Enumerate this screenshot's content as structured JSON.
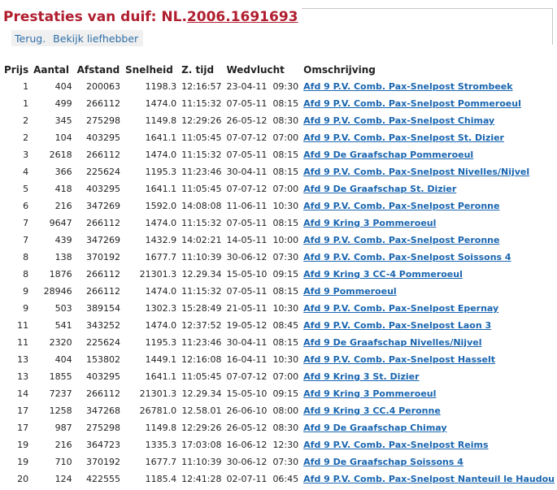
{
  "header": {
    "title_prefix": "Prestaties van duif: NL.",
    "ring_number": "2006.1691693",
    "nav": [
      {
        "label": "Terug."
      },
      {
        "label": "Bekijk liefhebber"
      }
    ]
  },
  "table": {
    "columns": [
      "Prijs",
      "Aantal",
      "Afstand",
      "Snelheid",
      "Z. tijd",
      "Wedvlucht",
      "Omschrijving"
    ],
    "rows": [
      {
        "prijs": "1",
        "aantal": "404",
        "afstand": "200063",
        "snelheid": "1198.3",
        "ztijd": "12:16:57",
        "datum": "23-04-11",
        "tijd": "09:30",
        "omschrijving": "Afd 9 P.V. Comb. Pax-Snelpost Strombeek"
      },
      {
        "prijs": "1",
        "aantal": "499",
        "afstand": "266112",
        "snelheid": "1474.0",
        "ztijd": "11:15:32",
        "datum": "07-05-11",
        "tijd": "08:15",
        "omschrijving": "Afd 9 P.V. Comb. Pax-Snelpost Pommeroeul"
      },
      {
        "prijs": "2",
        "aantal": "345",
        "afstand": "275298",
        "snelheid": "1149.8",
        "ztijd": "12:29:26",
        "datum": "26-05-12",
        "tijd": "08:30",
        "omschrijving": "Afd 9 P.V. Comb. Pax-Snelpost Chimay"
      },
      {
        "prijs": "2",
        "aantal": "104",
        "afstand": "403295",
        "snelheid": "1641.1",
        "ztijd": "11:05:45",
        "datum": "07-07-12",
        "tijd": "07:00",
        "omschrijving": "Afd 9 P.V. Comb. Pax-Snelpost St. Dizier"
      },
      {
        "prijs": "3",
        "aantal": "2618",
        "afstand": "266112",
        "snelheid": "1474.0",
        "ztijd": "11:15:32",
        "datum": "07-05-11",
        "tijd": "08:15",
        "omschrijving": "Afd 9 De Graafschap Pommeroeul"
      },
      {
        "prijs": "4",
        "aantal": "366",
        "afstand": "225624",
        "snelheid": "1195.3",
        "ztijd": "11:23:46",
        "datum": "30-04-11",
        "tijd": "08:15",
        "omschrijving": "Afd 9 P.V. Comb. Pax-Snelpost Nivelles/Nijvel"
      },
      {
        "prijs": "5",
        "aantal": "418",
        "afstand": "403295",
        "snelheid": "1641.1",
        "ztijd": "11:05:45",
        "datum": "07-07-12",
        "tijd": "07:00",
        "omschrijving": "Afd 9 De Graafschap St. Dizier"
      },
      {
        "prijs": "6",
        "aantal": "216",
        "afstand": "347269",
        "snelheid": "1592.0",
        "ztijd": "14:08:08",
        "datum": "11-06-11",
        "tijd": "10:30",
        "omschrijving": "Afd 9 P.V. Comb. Pax-Snelpost Peronne"
      },
      {
        "prijs": "7",
        "aantal": "9647",
        "afstand": "266112",
        "snelheid": "1474.0",
        "ztijd": "11:15:32",
        "datum": "07-05-11",
        "tijd": "08:15",
        "omschrijving": "Afd 9 Kring 3 Pommeroeul"
      },
      {
        "prijs": "7",
        "aantal": "439",
        "afstand": "347269",
        "snelheid": "1432.9",
        "ztijd": "14:02:21",
        "datum": "14-05-11",
        "tijd": "10:00",
        "omschrijving": "Afd 9 P.V. Comb. Pax-Snelpost Peronne"
      },
      {
        "prijs": "8",
        "aantal": "138",
        "afstand": "370192",
        "snelheid": "1677.7",
        "ztijd": "11:10:39",
        "datum": "30-06-12",
        "tijd": "07:30",
        "omschrijving": "Afd 9 P.V. Comb. Pax-Snelpost Soissons 4"
      },
      {
        "prijs": "8",
        "aantal": "1876",
        "afstand": "266112",
        "snelheid": "21301.3",
        "ztijd": "12.29.34",
        "datum": "15-05-10",
        "tijd": "09:15",
        "omschrijving": "Afd 9 Kring 3 CC-4 Pommeroeul"
      },
      {
        "prijs": "9",
        "aantal": "28946",
        "afstand": "266112",
        "snelheid": "1474.0",
        "ztijd": "11:15:32",
        "datum": "07-05-11",
        "tijd": "08:15",
        "omschrijving": "Afd 9 Pommeroeul"
      },
      {
        "prijs": "9",
        "aantal": "503",
        "afstand": "389154",
        "snelheid": "1302.3",
        "ztijd": "15:28:49",
        "datum": "21-05-11",
        "tijd": "10:30",
        "omschrijving": "Afd 9 P.V. Comb. Pax-Snelpost Epernay"
      },
      {
        "prijs": "11",
        "aantal": "541",
        "afstand": "343252",
        "snelheid": "1474.0",
        "ztijd": "12:37:52",
        "datum": "19-05-12",
        "tijd": "08:45",
        "omschrijving": "Afd 9 P.V. Comb. Pax-Snelpost Laon 3"
      },
      {
        "prijs": "11",
        "aantal": "2320",
        "afstand": "225624",
        "snelheid": "1195.3",
        "ztijd": "11:23:46",
        "datum": "30-04-11",
        "tijd": "08:15",
        "omschrijving": "Afd 9 De Graafschap Nivelles/Nijvel"
      },
      {
        "prijs": "13",
        "aantal": "404",
        "afstand": "153802",
        "snelheid": "1449.1",
        "ztijd": "12:16:08",
        "datum": "16-04-11",
        "tijd": "10:30",
        "omschrijving": "Afd 9 P.V. Comb. Pax-Snelpost Hasselt"
      },
      {
        "prijs": "13",
        "aantal": "1855",
        "afstand": "403295",
        "snelheid": "1641.1",
        "ztijd": "11:05:45",
        "datum": "07-07-12",
        "tijd": "07:00",
        "omschrijving": "Afd 9 Kring 3 St. Dizier"
      },
      {
        "prijs": "14",
        "aantal": "7237",
        "afstand": "266112",
        "snelheid": "21301.3",
        "ztijd": "12.29.34",
        "datum": "15-05-10",
        "tijd": "09:15",
        "omschrijving": "Afd 9 Kring 3 Pommeroeul"
      },
      {
        "prijs": "17",
        "aantal": "1258",
        "afstand": "347268",
        "snelheid": "26781.0",
        "ztijd": "12.58.01",
        "datum": "26-06-10",
        "tijd": "08:00",
        "omschrijving": "Afd 9 Kring 3 CC.4 Peronne"
      },
      {
        "prijs": "17",
        "aantal": "987",
        "afstand": "275298",
        "snelheid": "1149.8",
        "ztijd": "12:29:26",
        "datum": "26-05-12",
        "tijd": "08:30",
        "omschrijving": "Afd 9 De Graafschap Chimay"
      },
      {
        "prijs": "19",
        "aantal": "216",
        "afstand": "364723",
        "snelheid": "1335.3",
        "ztijd": "17:03:08",
        "datum": "16-06-12",
        "tijd": "12:30",
        "omschrijving": "Afd 9 P.V. Comb. Pax-Snelpost Reims"
      },
      {
        "prijs": "19",
        "aantal": "710",
        "afstand": "370192",
        "snelheid": "1677.7",
        "ztijd": "11:10:39",
        "datum": "30-06-12",
        "tijd": "07:30",
        "omschrijving": "Afd 9 De Graafschap Soissons 4"
      },
      {
        "prijs": "20",
        "aantal": "124",
        "afstand": "422555",
        "snelheid": "1185.4",
        "ztijd": "12:41:28",
        "datum": "02-07-11",
        "tijd": "06:45",
        "omschrijving": "Afd 9 P.V. Comb. Pax-Snelpost Nanteuil le Haudou"
      }
    ]
  }
}
